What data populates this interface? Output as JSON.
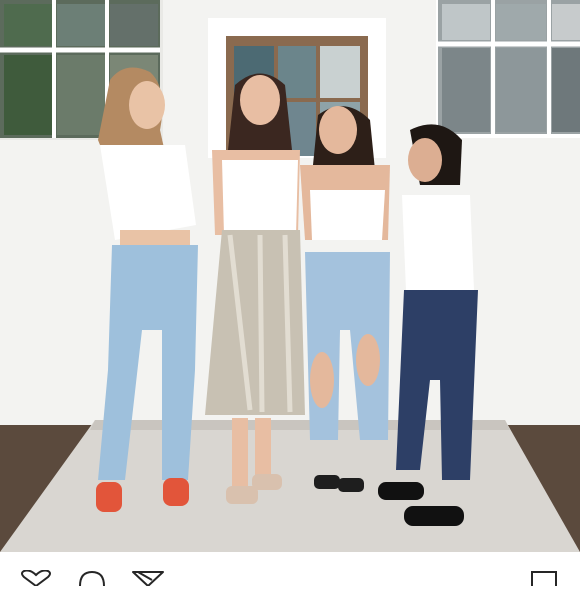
{
  "post": {
    "image_kind": "photo",
    "icons": {
      "like": "heart-icon",
      "comment": "comment-icon",
      "share": "send-icon",
      "save": "bookmark-icon"
    },
    "colors": {
      "wall": "#f3f3f1",
      "sidewalk": "#d9d6d1",
      "light_denim": "#9ec0dc",
      "dark_denim": "#2d3f66",
      "sequin_skirt": "#c8c1b3",
      "sandals_orange": "#e2553a",
      "icon_stroke": "#262626"
    }
  }
}
